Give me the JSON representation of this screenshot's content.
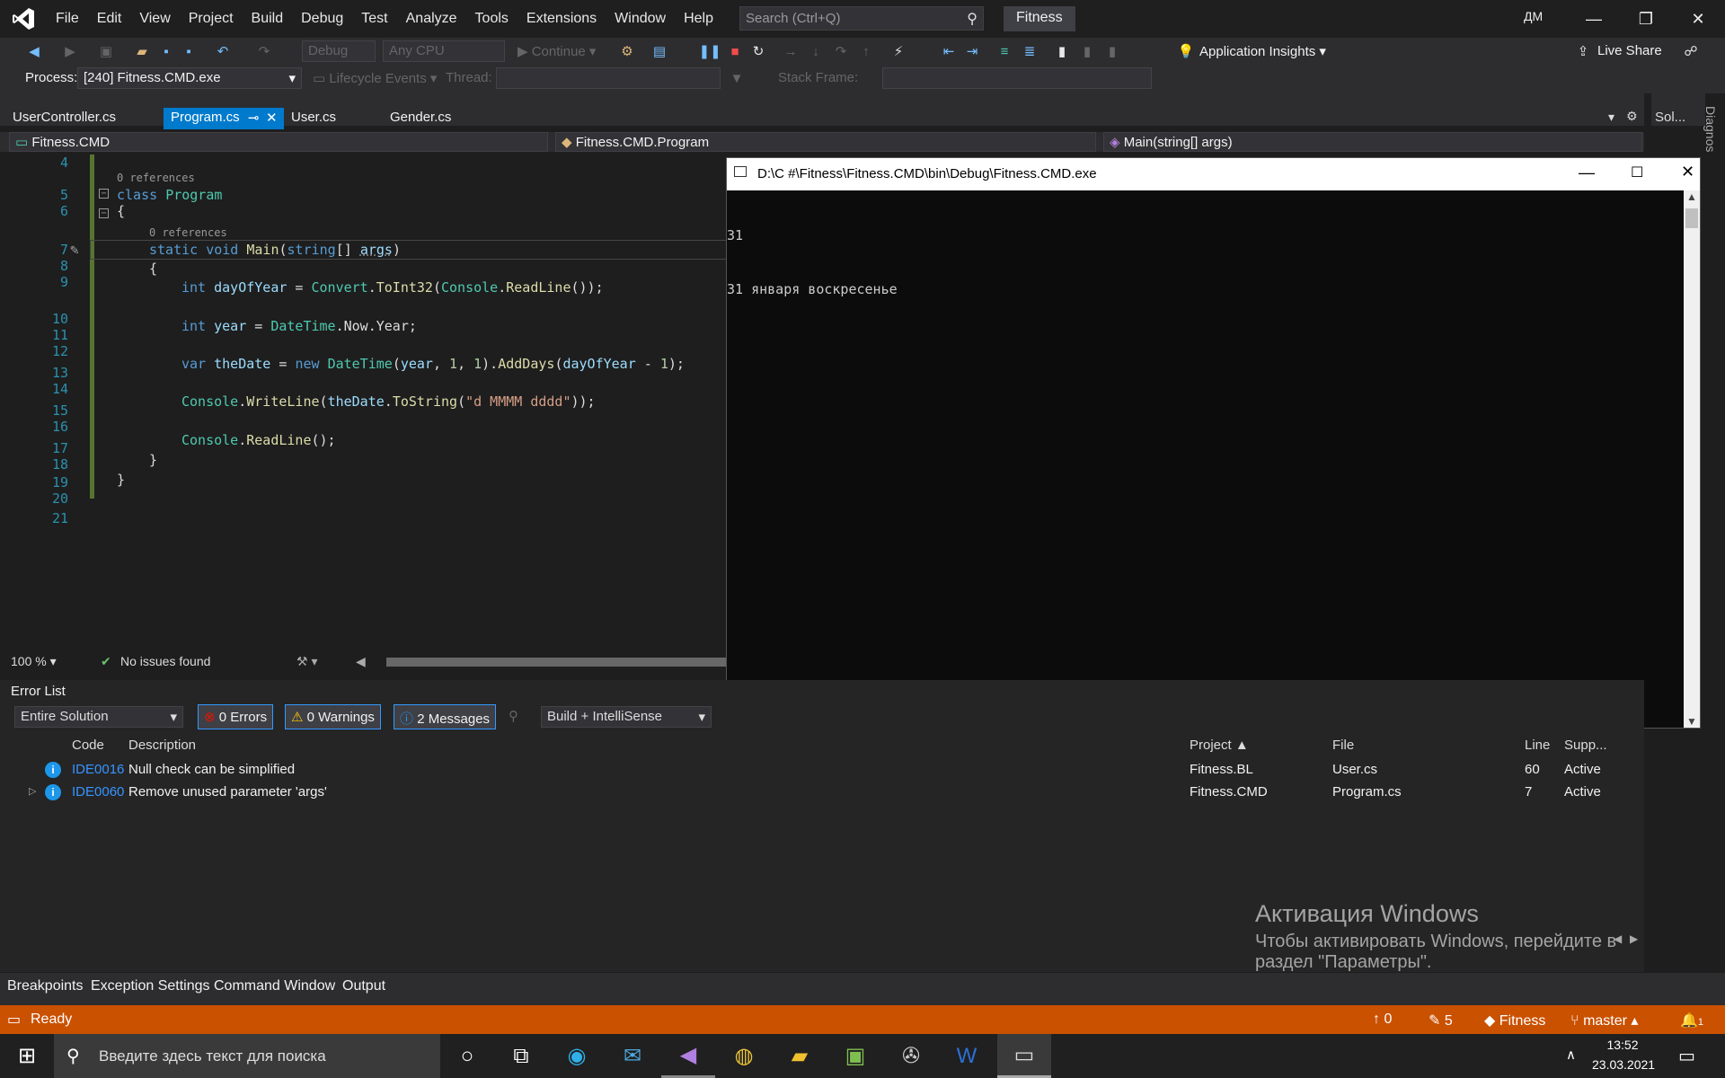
{
  "menubar": {
    "items": [
      "File",
      "Edit",
      "View",
      "Project",
      "Build",
      "Debug",
      "Test",
      "Analyze",
      "Tools",
      "Extensions",
      "Window",
      "Help"
    ],
    "search_placeholder": "Search (Ctrl+Q)",
    "solution_name": "Fitness",
    "avatar_initials": "ДМ"
  },
  "toolbar": {
    "config": "Debug",
    "platform": "Any CPU",
    "continue_label": "Continue",
    "app_insights": "Application Insights",
    "live_share": "Live Share"
  },
  "debug_toolbar": {
    "process_label": "Process:",
    "process_value": "[240] Fitness.CMD.exe",
    "lifecycle_label": "Lifecycle Events",
    "thread_label": "Thread:",
    "stack_frame_label": "Stack Frame:"
  },
  "tabs": [
    {
      "label": "UserController.cs",
      "active": false
    },
    {
      "label": "Program.cs",
      "active": true
    },
    {
      "label": "User.cs",
      "active": false
    },
    {
      "label": "Gender.cs",
      "active": false
    }
  ],
  "right_panel": {
    "solution_tab": "Sol...",
    "diag_tab": "Diagnos"
  },
  "navbar": {
    "project": "Fitness.CMD",
    "class": "Fitness.CMD.Program",
    "member": "Main(string[] args)"
  },
  "editor": {
    "line_numbers": [
      "4",
      "5",
      "6",
      "7",
      "8",
      "9",
      "10",
      "11",
      "12",
      "13",
      "14",
      "15",
      "16",
      "17",
      "18",
      "19",
      "20",
      "21"
    ],
    "codelens_class": "0 references",
    "codelens_main": "0 references",
    "code": {
      "l5_kw": "class",
      "l5_name": "Program",
      "l6": "{",
      "l7_static": "static",
      "l7_void": "void",
      "l7_main": "Main",
      "l7_string": "string",
      "l7_args": "args",
      "l8": "{",
      "l9_int": "int",
      "l9_var": "dayOfYear",
      "l9_eq": " = ",
      "l9_convert": "Convert",
      "l9_dot": ".",
      "l9_toint": "ToInt32",
      "l9_console": "Console",
      "l9_readline": "ReadLine",
      "l9_end": "());",
      "l11_int": "int",
      "l11_var": "year",
      "l11_eq": " = ",
      "l11_dt": "DateTime",
      "l11_rest": ".Now.Year;",
      "l13_var": "var",
      "l13_name": "theDate",
      "l13_eq": " = ",
      "l13_new": "new",
      "l13_dt": "DateTime",
      "l13_year": "year",
      "l13_one": "1",
      "l13_adddays": "AddDays",
      "l13_doy": "dayOfYear",
      "l13_rest": " - ",
      "l15_console": "Console",
      "l15_wl": "WriteLine",
      "l15_thedate": "theDate",
      "l15_tostring": "ToString",
      "l15_str": "\"d MMMM dddd\"",
      "l15_end": "));",
      "l17_console": "Console",
      "l17_rl": "ReadLine",
      "l17_end": "();",
      "l18": "}",
      "l19": "}"
    }
  },
  "editor_status": {
    "zoom": "100 %",
    "issues": "No issues found"
  },
  "console": {
    "title": "D:\\C #\\Fitness\\Fitness.CMD\\bin\\Debug\\Fitness.CMD.exe",
    "lines": [
      "31",
      "31 января воскресенье"
    ]
  },
  "error_list": {
    "title": "Error List",
    "scope": "Entire Solution",
    "errors": "0 Errors",
    "warnings": "0 Warnings",
    "messages": "2 Messages",
    "source": "Build + IntelliSense",
    "columns": {
      "code": "Code",
      "description": "Description",
      "project": "Project",
      "file": "File",
      "line": "Line",
      "supp": "Supp..."
    },
    "rows": [
      {
        "code": "IDE0016",
        "description": "Null check can be simplified",
        "project": "Fitness.BL",
        "file": "User.cs",
        "line": "60",
        "supp": "Active"
      },
      {
        "code": "IDE0060",
        "description": "Remove unused parameter 'args'",
        "project": "Fitness.CMD",
        "file": "Program.cs",
        "line": "7",
        "supp": "Active"
      }
    ]
  },
  "bottom_tabs": [
    "Breakpoints",
    "Exception Settings",
    "Command Window",
    "Output"
  ],
  "statusbar": {
    "state": "Ready",
    "up_count": "0",
    "edit_count": "5",
    "repo": "Fitness",
    "branch": "master",
    "notifications": "1"
  },
  "watermark": {
    "title": "Активация Windows",
    "line1": "Чтобы активировать Windows, перейдите в",
    "line2": "раздел \"Параметры\"."
  },
  "taskbar": {
    "search_placeholder": "Введите здесь текст для поиска",
    "time": "13:52",
    "date": "23.03.2021"
  },
  "colors": {
    "accent": "#007acc",
    "status_debug": "#ca5100",
    "line_number": "#2b91af"
  }
}
